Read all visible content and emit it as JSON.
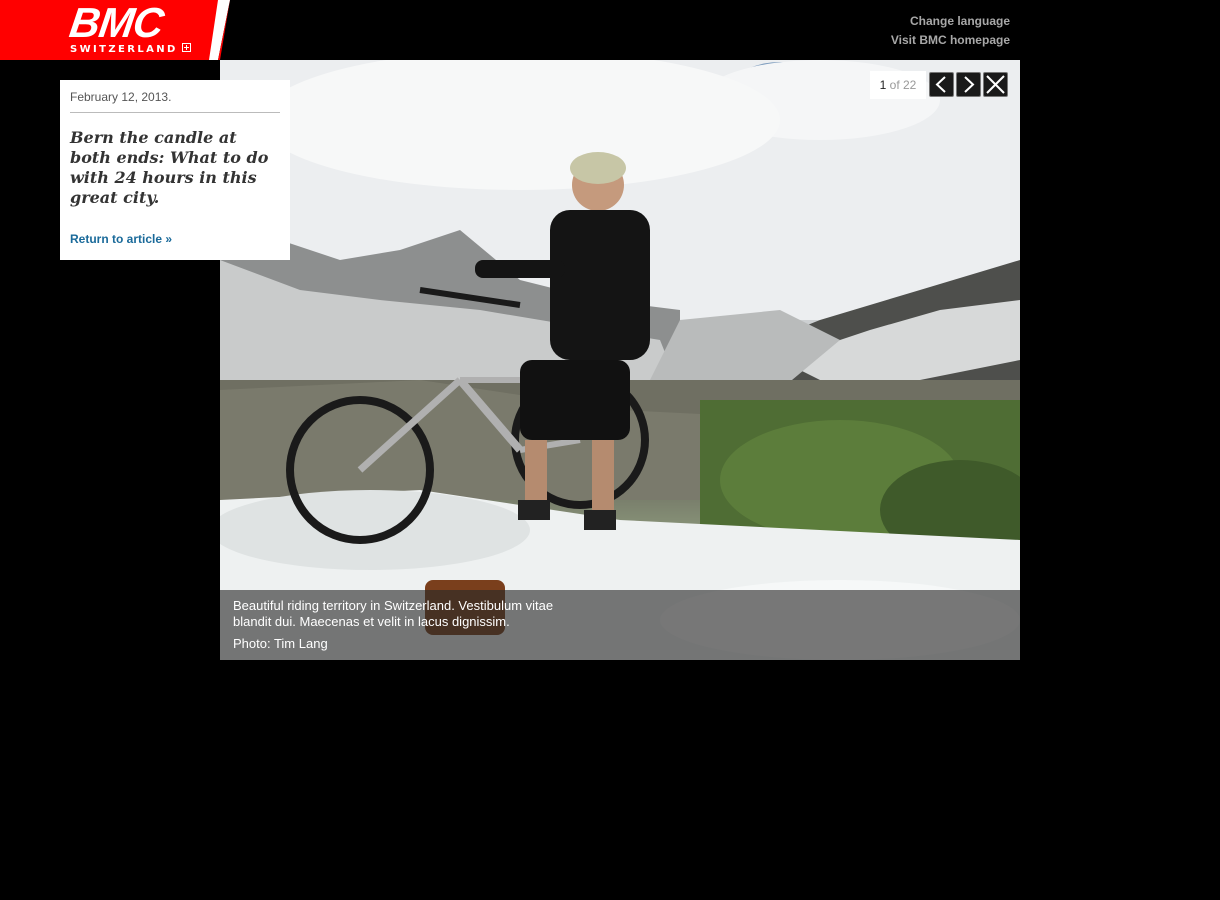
{
  "brand": {
    "logo_text": "BMC",
    "logo_sub": "SWITZERLAND",
    "logo_color": "#ff0000"
  },
  "header": {
    "change_language": "Change language",
    "visit_homepage": "Visit BMC homepage"
  },
  "article": {
    "date": "February 12, 2013.",
    "title": "Bern the candle at both ends: What to do with 24 hours in this great city.",
    "return_link": "Return to article »"
  },
  "gallery": {
    "current": "1",
    "of_label": "of 22",
    "prev_icon": "chevron-left-icon",
    "next_icon": "chevron-right-icon",
    "close_icon": "close-icon",
    "caption": "Beautiful riding territory in Switzerland. Vestibulum vitae blandit dui. Maecenas et velit in lacus dignissim.",
    "credit": "Photo: Tim Lang"
  }
}
